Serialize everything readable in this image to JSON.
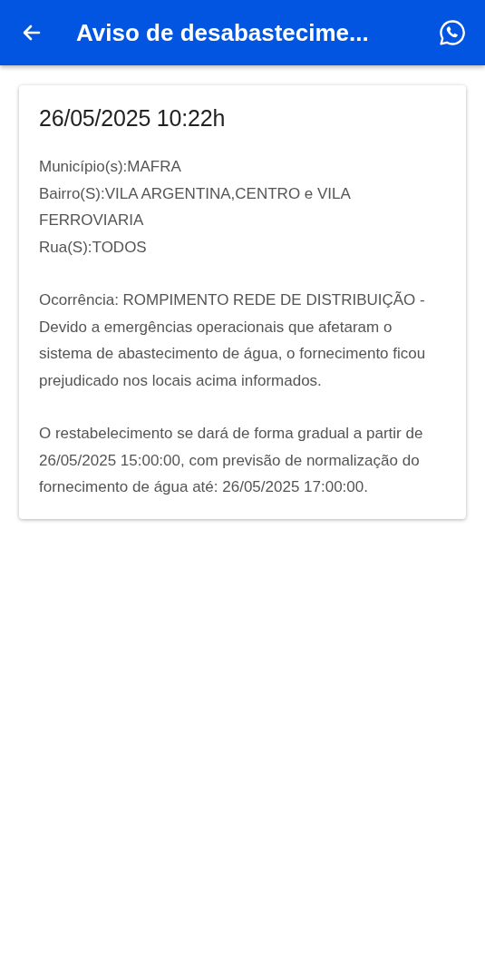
{
  "app_bar": {
    "title": "Aviso de desabastecime..."
  },
  "notice": {
    "date": "26/05/2025 10:22h",
    "location_lines": [
      "Município(s):MAFRA",
      "Bairro(S):VILA ARGENTINA,CENTRO e VILA FERROVIARIA",
      "Rua(S):TODOS"
    ],
    "paragraphs": [
      "Ocorrência: ROMPIMENTO REDE DE DISTRIBUIÇÃO - Devido a emergências operacionais que afetaram o sistema de abastecimento de água, o fornecimento ficou prejudicado nos locais acima informados.",
      "O restabelecimento se dará de forma gradual a partir de 26/05/2025 15:00:00, com previsão de normalização do fornecimento de água até: 26/05/2025 17:00:00."
    ]
  }
}
